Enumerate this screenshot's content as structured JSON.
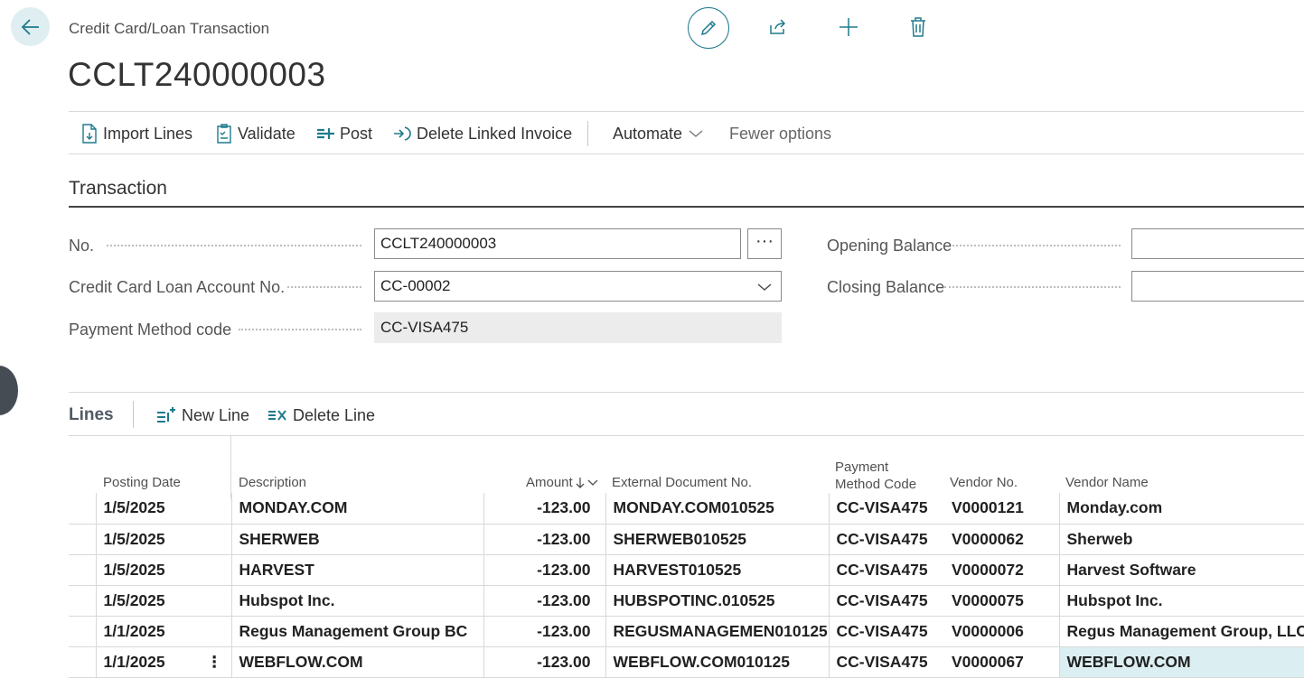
{
  "header": {
    "breadcrumb": "Credit Card/Loan Transaction",
    "title": "CCLT240000003"
  },
  "top_actions": [
    "pencil-icon",
    "share-icon",
    "plus-icon",
    "trash-icon"
  ],
  "actionbar": {
    "import_lines": "Import Lines",
    "validate": "Validate",
    "post": "Post",
    "delete_linked_invoice": "Delete Linked Invoice",
    "automate": "Automate",
    "fewer_options": "Fewer options"
  },
  "transaction": {
    "section_title": "Transaction",
    "no_label": "No.",
    "no_value": "CCLT240000003",
    "account_label": "Credit Card Loan Account No.",
    "account_value": "CC-00002",
    "payment_label": "Payment Method code",
    "payment_value": "CC-VISA475",
    "opening_label": "Opening Balance",
    "opening_value": "",
    "closing_label": "Closing Balance",
    "closing_value": "",
    "ellipsis": "···"
  },
  "lines": {
    "title": "Lines",
    "new_line": "New Line",
    "delete_line": "Delete Line",
    "columns": {
      "posting_date": "Posting Date",
      "description": "Description",
      "amount": "Amount",
      "external_doc": "External Document No.",
      "payment_method_1": "Payment",
      "payment_method_2": "Method Code",
      "vendor_no": "Vendor No.",
      "vendor_name": "Vendor Name"
    },
    "rows": [
      {
        "date": "1/5/2025",
        "description": "MONDAY.COM",
        "amount": "-123.00",
        "external": "MONDAY.COM010525",
        "payment": "CC-VISA475",
        "vendor_no": "V0000121",
        "vendor_name": "Monday.com"
      },
      {
        "date": "1/5/2025",
        "description": "SHERWEB",
        "amount": "-123.00",
        "external": "SHERWEB010525",
        "payment": "CC-VISA475",
        "vendor_no": "V0000062",
        "vendor_name": "Sherweb"
      },
      {
        "date": "1/5/2025",
        "description": "HARVEST",
        "amount": "-123.00",
        "external": "HARVEST010525",
        "payment": "CC-VISA475",
        "vendor_no": "V0000072",
        "vendor_name": "Harvest Software"
      },
      {
        "date": "1/5/2025",
        "description": "Hubspot Inc.",
        "amount": "-123.00",
        "external": "HUBSPOTINC.010525",
        "payment": "CC-VISA475",
        "vendor_no": "V0000075",
        "vendor_name": "Hubspot Inc."
      },
      {
        "date": "1/1/2025",
        "description": "Regus Management Group BC",
        "amount": "-123.00",
        "external": "REGUSMANAGEMEN010125",
        "payment": "CC-VISA475",
        "vendor_no": "V0000006",
        "vendor_name": "Regus Management Group, LLC"
      },
      {
        "date": "1/1/2025",
        "description": "WEBFLOW.COM",
        "amount": "-123.00",
        "external": "WEBFLOW.COM010125",
        "payment": "CC-VISA475",
        "vendor_no": "V0000067",
        "vendor_name": "WEBFLOW.COM",
        "menu": "⋮"
      }
    ]
  }
}
